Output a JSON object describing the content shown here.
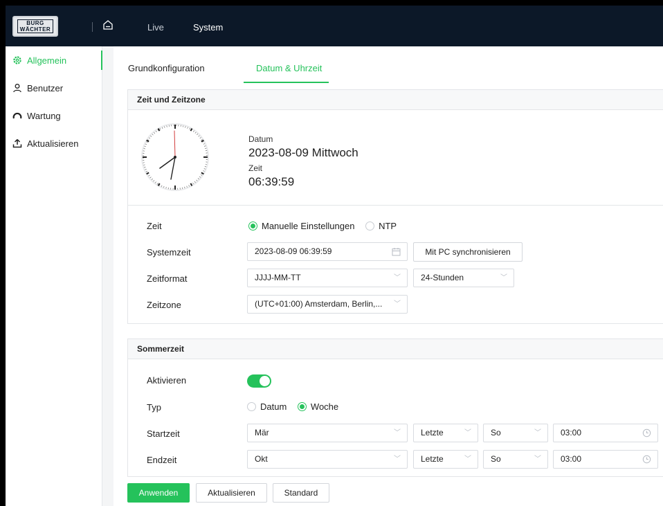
{
  "brand": {
    "logo_text": "BURG\nWÄCHTER"
  },
  "topnav": {
    "live": "Live",
    "system": "System"
  },
  "sidebar": {
    "items": [
      {
        "label": "Allgemein",
        "icon": "gear-icon",
        "active": true
      },
      {
        "label": "Benutzer",
        "icon": "user-icon",
        "active": false
      },
      {
        "label": "Wartung",
        "icon": "gauge-icon",
        "active": false
      },
      {
        "label": "Aktualisieren",
        "icon": "upload-icon",
        "active": false
      }
    ]
  },
  "tabs": [
    {
      "label": "Grundkonfiguration",
      "active": false
    },
    {
      "label": "Datum & Uhrzeit",
      "active": true
    }
  ],
  "time_section": {
    "title": "Zeit und Zeitzone",
    "date_label": "Datum",
    "date_value": "2023-08-09 Mittwoch",
    "time_label": "Zeit",
    "time_value": "06:39:59",
    "rows": {
      "zeit_label": "Zeit",
      "zeit_options": [
        "Manuelle Einstellungen",
        "NTP"
      ],
      "zeit_selected": "Manuelle Einstellungen",
      "systemzeit_label": "Systemzeit",
      "systemzeit_value": "2023-08-09 06:39:59",
      "sync_button": "Mit PC synchronisieren",
      "zeitformat_label": "Zeitformat",
      "zeitformat_value": "JJJJ-MM-TT",
      "stundenformat_value": "24-Stunden",
      "zeitzone_label": "Zeitzone",
      "zeitzone_value": "(UTC+01:00) Amsterdam, Berlin,..."
    }
  },
  "dst_section": {
    "title": "Sommerzeit",
    "aktivieren_label": "Aktivieren",
    "aktivieren_on": true,
    "typ_label": "Typ",
    "typ_options": [
      "Datum",
      "Woche"
    ],
    "typ_selected": "Woche",
    "startzeit_label": "Startzeit",
    "start": {
      "month": "Mär",
      "week": "Letzte",
      "day": "So",
      "time": "03:00"
    },
    "endzeit_label": "Endzeit",
    "end": {
      "month": "Okt",
      "week": "Letzte",
      "day": "So",
      "time": "03:00"
    }
  },
  "actions": {
    "apply": "Anwenden",
    "refresh": "Aktualisieren",
    "default": "Standard"
  },
  "colors": {
    "accent": "#25c25b",
    "topbar": "#0c1828"
  }
}
